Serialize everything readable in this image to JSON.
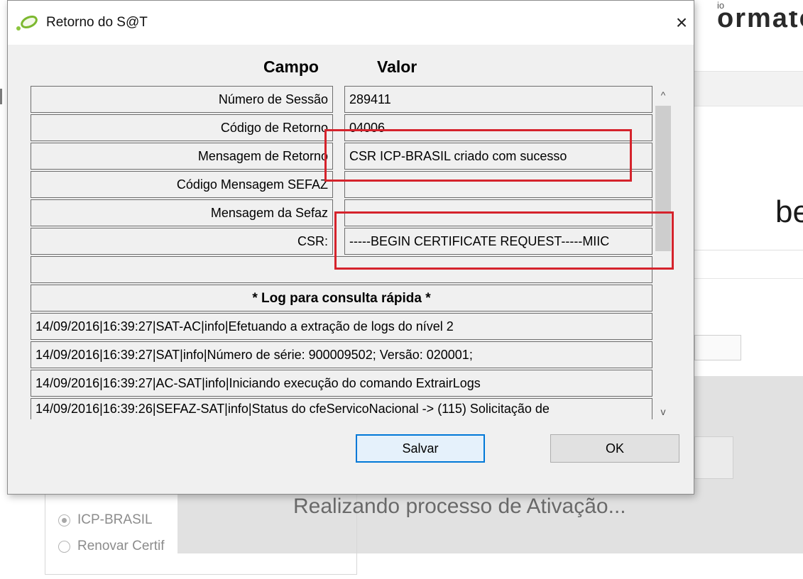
{
  "dialog": {
    "title": "Retorno do S@T",
    "close_glyph": "×",
    "columns": {
      "campo": "Campo",
      "valor": "Valor"
    },
    "fields": [
      {
        "label": "Número de Sessão",
        "value": "289411"
      },
      {
        "label": "Código de Retorno",
        "value": "04006"
      },
      {
        "label": "Mensagem de Retorno",
        "value": "CSR ICP-BRASIL criado com sucesso"
      },
      {
        "label": "Código Mensagem SEFAZ",
        "value": ""
      },
      {
        "label": "Mensagem da Sefaz",
        "value": ""
      },
      {
        "label": "CSR:",
        "value": "-----BEGIN CERTIFICATE REQUEST-----MIIC"
      }
    ],
    "log_header": "* Log para consulta rápida *",
    "log_lines": [
      "14/09/2016|16:39:27|SAT-AC|info|Efetuando a extração de logs do nível 2",
      "14/09/2016|16:39:27|SAT|info|Número de série: 900009502; Versão: 020001;",
      "14/09/2016|16:39:27|AC-SAT|info|Iniciando execução do comando ExtrairLogs",
      "14/09/2016|16:39:26|SEFAZ-SAT|info|Status do cfeServicoNacional -> (115) Solicitação de"
    ],
    "buttons": {
      "save": "Salvar",
      "ok": "OK"
    },
    "scroll_up_glyph": "^",
    "scroll_down_glyph": "v",
    "highlight_color": "#d5232c",
    "icons": {
      "app": "sat-leaf-icon",
      "close": "close-icon"
    }
  },
  "background": {
    "title_fragment": "ormato",
    "small_fragment": "io",
    "heading_fragment": "be",
    "progress_text": "Realizando processo de Ativação...",
    "radios": [
      {
        "label": "ICP-BRASIL",
        "selected": true
      },
      {
        "label": "Renovar Certif",
        "selected": false
      }
    ]
  }
}
